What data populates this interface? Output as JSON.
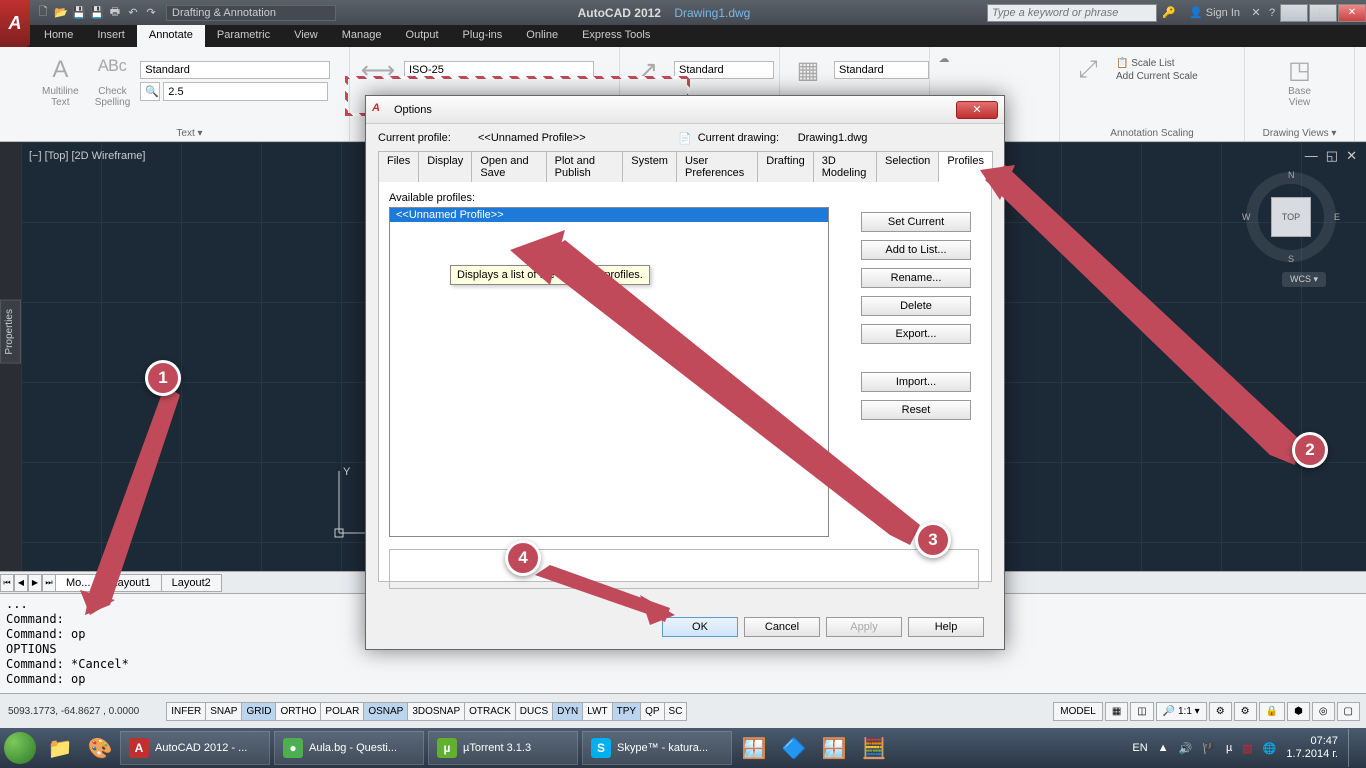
{
  "titlebar": {
    "app": "AutoCAD 2012",
    "doc": "Drawing1.dwg",
    "workspace": "Drafting & Annotation",
    "search_placeholder": "Type a keyword or phrase",
    "signin": "Sign In"
  },
  "menus": [
    "Home",
    "Insert",
    "Annotate",
    "Parametric",
    "View",
    "Manage",
    "Output",
    "Plug-ins",
    "Online",
    "Express Tools"
  ],
  "menu_active": "Annotate",
  "ribbon": {
    "text": {
      "ml": "Multiline\nText",
      "chk": "Check\nSpelling",
      "style": "Standard",
      "h": "2.5",
      "title": "Text ▾"
    },
    "dim": {
      "style": "ISO-25"
    },
    "lead": {
      "style": "Standard"
    },
    "tbl": {
      "style": "Standard"
    },
    "scale": {
      "list": "Scale List",
      "add": "Add Current Scale",
      "title": "Annotation Scaling"
    },
    "view": {
      "base": "Base\nView",
      "title": "Drawing Views ▾"
    }
  },
  "viewport": "[−] [Top] [2D Wireframe]",
  "cube": {
    "top": "TOP",
    "n": "N",
    "s": "S",
    "e": "E",
    "w": "W"
  },
  "wcs": "WCS ▾",
  "props": "Properties",
  "model_tabs": [
    "Mo...",
    "Layout1",
    "Layout2"
  ],
  "cmd": [
    "...",
    "Command:",
    "Command: op",
    "OPTIONS",
    "Command: *Cancel*",
    "Command: op"
  ],
  "coords": "5093.1773, -64.8627 , 0.0000",
  "toggles": [
    "INFER",
    "SNAP",
    "GRID",
    "ORTHO",
    "POLAR",
    "OSNAP",
    "3DOSNAP",
    "OTRACK",
    "DUCS",
    "DYN",
    "LWT",
    "TPY",
    "QP",
    "SC"
  ],
  "toggles_on": [
    "GRID",
    "OSNAP",
    "DYN",
    "TPY"
  ],
  "status_right": {
    "model": "MODEL",
    "scale": "🔎 1:1 ▾"
  },
  "dialog": {
    "title": "Options",
    "profile_lbl": "Current profile:",
    "profile_val": "<<Unnamed Profile>>",
    "drawing_lbl": "Current drawing:",
    "drawing_val": "Drawing1.dwg",
    "tabs": [
      "Files",
      "Display",
      "Open and Save",
      "Plot and Publish",
      "System",
      "User Preferences",
      "Drafting",
      "3D Modeling",
      "Selection",
      "Profiles"
    ],
    "tab_active": "Profiles",
    "avail": "Available profiles:",
    "item": "<<Unnamed Profile>>",
    "buttons": [
      "Set Current",
      "Add to List...",
      "Rename...",
      "Delete",
      "Export...",
      "Import...",
      "Reset"
    ],
    "tooltip": "Displays a list of the available profiles.",
    "ok": "OK",
    "cancel": "Cancel",
    "apply": "Apply",
    "help": "Help"
  },
  "taskbar": {
    "tasks": [
      {
        "icon": "A",
        "label": "AutoCAD 2012 - ...",
        "color": "#c03030"
      },
      {
        "icon": "●",
        "label": "Aula.bg - Questi...",
        "color": "#4caf50"
      },
      {
        "icon": "µ",
        "label": "µTorrent 3.1.3",
        "color": "#62b030"
      },
      {
        "icon": "S",
        "label": "Skype™ - katura...",
        "color": "#00aff0"
      }
    ],
    "lang": "EN",
    "time": "07:47",
    "date": "1.7.2014 г."
  }
}
